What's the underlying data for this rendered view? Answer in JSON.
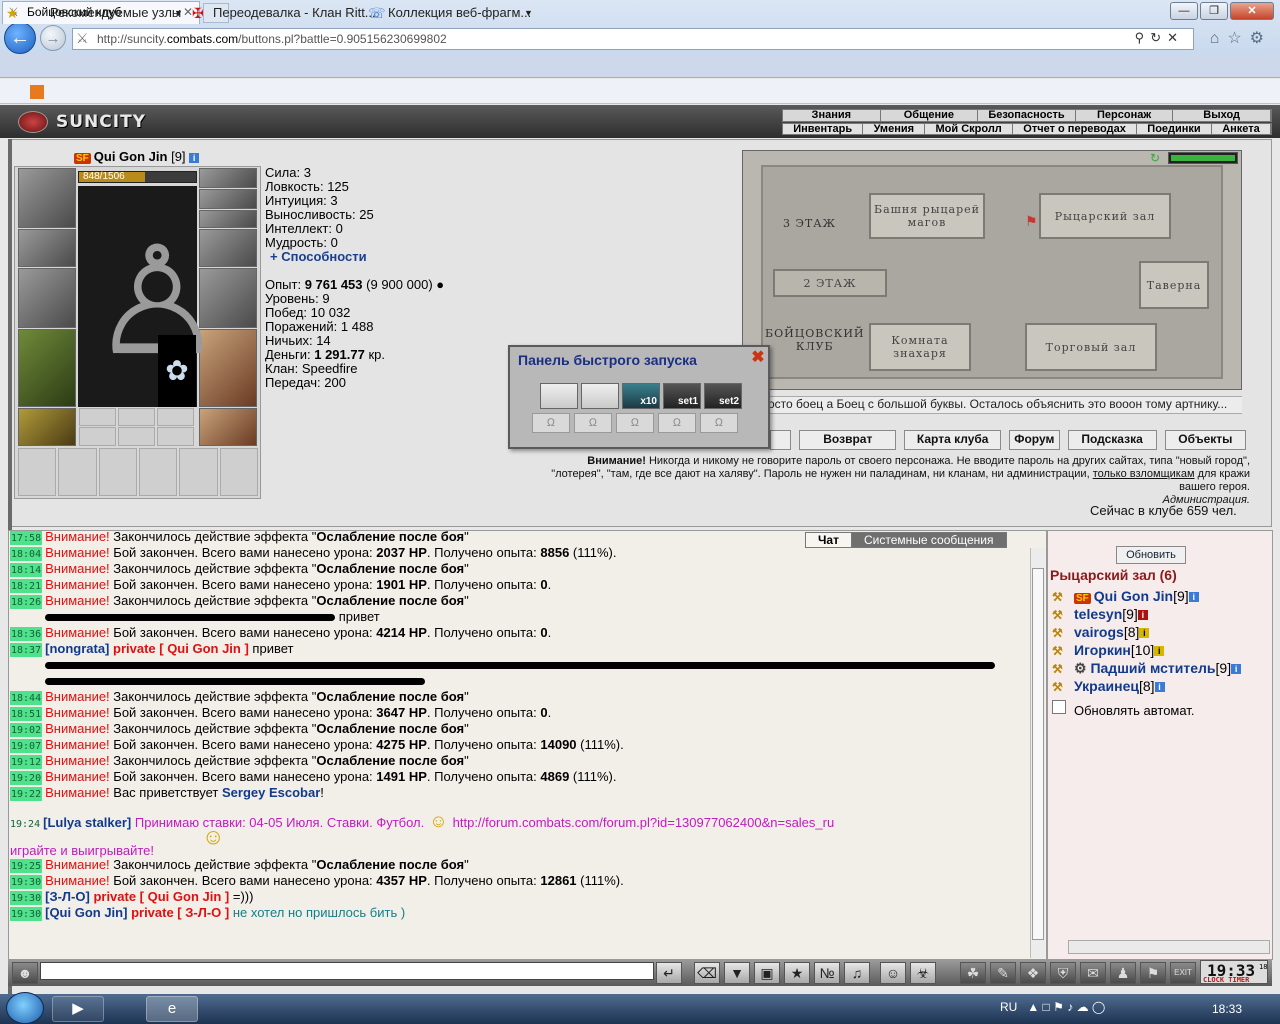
{
  "browser": {
    "url_prefix": "http://suncity.",
    "url_domain": "combats.com",
    "url_rest": "/buttons.pl?battle=0.905156230699802",
    "tab_title": "Бойцовский клуб",
    "favorites": [
      "Рекомендуемые узлы",
      "Переодевалка - Клан Ritt...",
      "Коллекция веб-фрагм..."
    ]
  },
  "game": {
    "logo": "SUNCITY",
    "top_menu": [
      "Знания",
      "Общение",
      "Безопасность",
      "Персонаж",
      "Выход"
    ],
    "sub_menu": [
      "Инвентарь",
      "Умения",
      "Мой Скролл",
      "Отчет о переводах",
      "Поединки",
      "Анкета"
    ]
  },
  "character": {
    "badge": "SF",
    "name": "Qui Gon Jin",
    "level": "[9]",
    "hp": "848/1506",
    "hp_fraction": 0.563,
    "stats": [
      {
        "label": "Сила:",
        "value": "3"
      },
      {
        "label": "Ловкость:",
        "value": "125"
      },
      {
        "label": "Интуиция:",
        "value": "3"
      },
      {
        "label": "Выносливость:",
        "value": "25"
      },
      {
        "label": "Интеллект:",
        "value": "0"
      },
      {
        "label": "Мудрость:",
        "value": "0"
      }
    ],
    "abilities": "+ Способности",
    "exp_label": "Опыт:",
    "exp_value": "9 761 453",
    "exp_next": "(9 900 000)",
    "level_label": "Уровень:",
    "level_value": "9",
    "wins_label": "Побед:",
    "wins_value": "10 032",
    "losses_label": "Поражений:",
    "losses_value": "1 488",
    "draws_label": "Ничьих:",
    "draws_value": "14",
    "money_label": "Деньги:",
    "money_value": "1 291.77",
    "money_unit": "кр.",
    "clan_label": "Клан:",
    "clan_value": "Speedfire",
    "transfers_label": "Передач:",
    "transfers_value": "200"
  },
  "map": {
    "floor3": "3 ЭТАЖ",
    "floor2": "2 ЭТАЖ",
    "club": "БОЙЦОВСКИЙ\nКЛУБ",
    "tower": "Башня рыцарей\nмагов",
    "knights_hall": "Рыцарский зал",
    "tavern": "Таверна",
    "healer": "Комната\nзнахаря",
    "trade": "Торговый зал",
    "ticker": "осто боец а Боец с большой буквы. Осталось объяснить это вооон тому артнику...",
    "buttons": [
      "Возврат",
      "Карта клуба",
      "Форум",
      "Подсказка",
      "Объекты"
    ]
  },
  "warning": {
    "bold": "Внимание!",
    "text1": " Никогда и никому не говорите пароль от своего персонажа. Не вводите пароль на других сайтах, типа \"новый город\",",
    "text2": "\"лотерея\", \"там, где все дают на халяву\". Пароль не нужен ни паладинам, ни кланам, ни администрации, ",
    "link": "только взломщикам",
    "text3": " для кражи",
    "text4": "вашего героя.",
    "admin": "Администрация."
  },
  "online": "Сейчас в клубе 659 чел.",
  "quick_launch": {
    "title": "Панель быстрого запуска",
    "slots": [
      "",
      "",
      "x10",
      "set1",
      "set2"
    ]
  },
  "chat": {
    "tabs": [
      "Чат",
      "Системные сообщения"
    ],
    "lines": [
      {
        "time": "17:58",
        "kind": "effect",
        "warn": "Внимание!",
        "text": " Закончилось действие эффекта \"",
        "bold": "Ослабление после боя",
        "end": "\""
      },
      {
        "time": "18:04",
        "kind": "fight",
        "warn": "Внимание!",
        "text": " Бой закончен. Всего вами нанесено урона: ",
        "dmg": "2037 HP",
        "text2": ". Получено опыта: ",
        "exp": "8856",
        "end": " (111%)."
      },
      {
        "time": "18:14",
        "kind": "effect",
        "warn": "Внимание!",
        "text": " Закончилось действие эффекта \"",
        "bold": "Ослабление после боя",
        "end": "\""
      },
      {
        "time": "18:21",
        "kind": "fight",
        "warn": "Внимание!",
        "text": " Бой закончен. Всего вами нанесено урона: ",
        "dmg": "1901 HP",
        "text2": ". Получено опыта: ",
        "exp": "0",
        "end": "."
      },
      {
        "time": "18:26",
        "kind": "effect",
        "warn": "Внимание!",
        "text": " Закончилось действие эффекта \"",
        "bold": "Ослабление после боя",
        "end": "\""
      },
      {
        "time": "",
        "kind": "redacted",
        "text": "привет"
      },
      {
        "time": "18:36",
        "kind": "fight",
        "warn": "Внимание!",
        "text": " Бой закончен. Всего вами нанесено урона: ",
        "dmg": "4214 HP",
        "text2": ". Получено опыта: ",
        "exp": "0",
        "end": "."
      },
      {
        "time": "18:37",
        "kind": "private",
        "from": "[nongrata]",
        "priv": "private [ Qui Gon Jin ]",
        "text": " привет"
      },
      {
        "time": "",
        "kind": "redacted2"
      },
      {
        "time": "",
        "kind": "redacted3"
      },
      {
        "time": "18:44",
        "kind": "effect",
        "warn": "Внимание!",
        "text": " Закончилось действие эффекта \"",
        "bold": "Ослабление после боя",
        "end": "\""
      },
      {
        "time": "18:51",
        "kind": "fight",
        "warn": "Внимание!",
        "text": " Бой закончен. Всего вами нанесено урона: ",
        "dmg": "3647 HP",
        "text2": ". Получено опыта: ",
        "exp": "0",
        "end": "."
      },
      {
        "time": "19:02",
        "kind": "effect",
        "warn": "Внимание!",
        "text": " Закончилось действие эффекта \"",
        "bold": "Ослабление после боя",
        "end": "\""
      },
      {
        "time": "19:07",
        "kind": "fight",
        "warn": "Внимание!",
        "text": " Бой закончен. Всего вами нанесено урона: ",
        "dmg": "4275 HP",
        "text2": ". Получено опыта: ",
        "exp": "14090",
        "end": " (111%)."
      },
      {
        "time": "19:12",
        "kind": "effect",
        "warn": "Внимание!",
        "text": " Закончилось действие эффекта \"",
        "bold": "Ослабление после боя",
        "end": "\""
      },
      {
        "time": "19:20",
        "kind": "fight",
        "warn": "Внимание!",
        "text": " Бой закончен. Всего вами нанесено урона: ",
        "dmg": "1491 HP",
        "text2": ". Получено опыта: ",
        "exp": "4869",
        "end": " (111%)."
      },
      {
        "time": "19:22",
        "kind": "welcome",
        "warn": "Внимание!",
        "text": " Вас приветствует ",
        "nick": "Sergey Escobar",
        "end": "!"
      }
    ],
    "lulya_time": "19:24",
    "lulya_nick": "[Lulya stalker]",
    "lulya_text": " Принимаю ставки: 04-05 Июля. Ставки. Футбол.",
    "lulya_link": "http://forum.combats.com/forum.pl?id=130977062400&n=sales_ru",
    "lulya_text2": "играйте и выигрывайте!",
    "tail": [
      {
        "time": "19:25",
        "kind": "effect",
        "warn": "Внимание!",
        "text": " Закончилось действие эффекта \"",
        "bold": "Ослабление после боя",
        "end": "\""
      },
      {
        "time": "19:30",
        "kind": "fight",
        "warn": "Внимание!",
        "text": " Бой закончен. Всего вами нанесено урона: ",
        "dmg": "4357 HP",
        "text2": ". Получено опыта: ",
        "exp": "12861",
        "end": " (111%)."
      },
      {
        "time": "19:30",
        "kind": "private",
        "from": "[З-Л-О]",
        "priv": "private [ Qui Gon Jin ]",
        "text": " =)))"
      },
      {
        "time": "19:30",
        "kind": "private2",
        "from": "[Qui Gon Jin]",
        "priv": "private [ З-Л-О ]",
        "text": " не хотел но пришлось бить )"
      }
    ]
  },
  "room": {
    "refresh": "Обновить",
    "title": "Рыцарский зал (6)",
    "users": [
      {
        "badge": "SF",
        "name": "Qui Gon Jin",
        "lvl": "[9]",
        "info": "blue"
      },
      {
        "badge": "",
        "name": "telesyn",
        "lvl": "[9]",
        "info": "red"
      },
      {
        "badge": "",
        "name": "vairogs",
        "lvl": "[8]",
        "info": "yel"
      },
      {
        "badge": "",
        "name": "Игоркин",
        "lvl": "[10]",
        "info": "yel"
      },
      {
        "badge": "",
        "name": "Падший мститель",
        "lvl": "[9]",
        "info": "blue"
      },
      {
        "badge": "",
        "name": "Украинец",
        "lvl": "[8]",
        "info": "blue"
      }
    ],
    "auto": "Обновлять автомат."
  },
  "clock": {
    "time": "19:33",
    "sec": "18",
    "label": "CLOCK TIMER"
  },
  "taskbar": {
    "lang": "RU",
    "time": "18:33"
  }
}
